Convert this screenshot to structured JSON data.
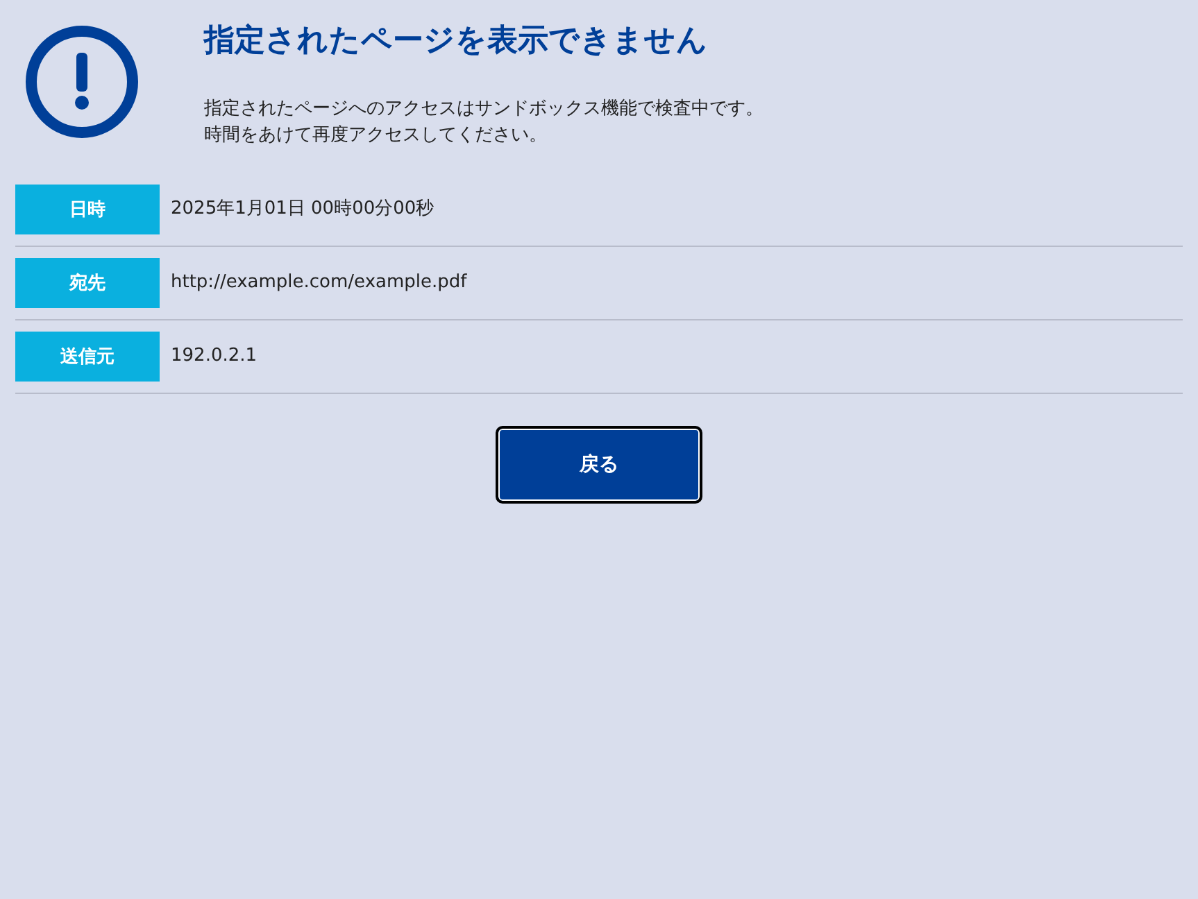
{
  "title": "指定されたページを表示できません",
  "message": [
    "指定されたページへのアクセスはサンドボックス機能で検査中です。",
    "時間をあけて再度アクセスしてください。"
  ],
  "details": [
    {
      "label": "日時",
      "value": "2025年1月01日 00時00分00秒"
    },
    {
      "label": "宛先",
      "value": "http://example.com/example.pdf"
    },
    {
      "label": "送信元",
      "value": "192.0.2.1"
    }
  ],
  "button": "戻る"
}
